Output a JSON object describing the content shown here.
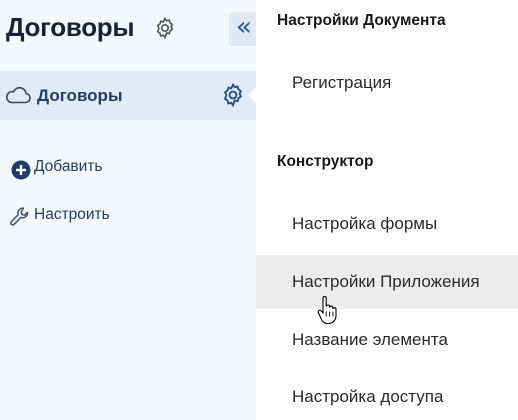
{
  "sidebar": {
    "title": "Договоры",
    "title_icon": "gear-icon",
    "collapse_label": "«",
    "active_item": {
      "label": "Договоры",
      "icon": "cloud-icon",
      "settings_icon": "gear-icon"
    },
    "actions": [
      {
        "label": "Добавить",
        "icon": "plus-circle-icon"
      },
      {
        "label": "Настроить",
        "icon": "wrench-icon"
      }
    ]
  },
  "menu": {
    "sections": [
      {
        "header": "Настройки Документа",
        "items": [
          {
            "label": "Регистрация"
          }
        ]
      },
      {
        "header": "Конструктор",
        "items": [
          {
            "label": "Настройка формы"
          },
          {
            "label": "Настройки Приложения",
            "hovered": true
          },
          {
            "label": "Название элемента"
          },
          {
            "label": "Настройка доступа"
          }
        ]
      }
    ]
  },
  "colors": {
    "sidebar_bg": "#f4f7fc",
    "active_bg": "#e2eaf5",
    "accent": "#1e5aa6",
    "hover_bg": "#ececec"
  }
}
